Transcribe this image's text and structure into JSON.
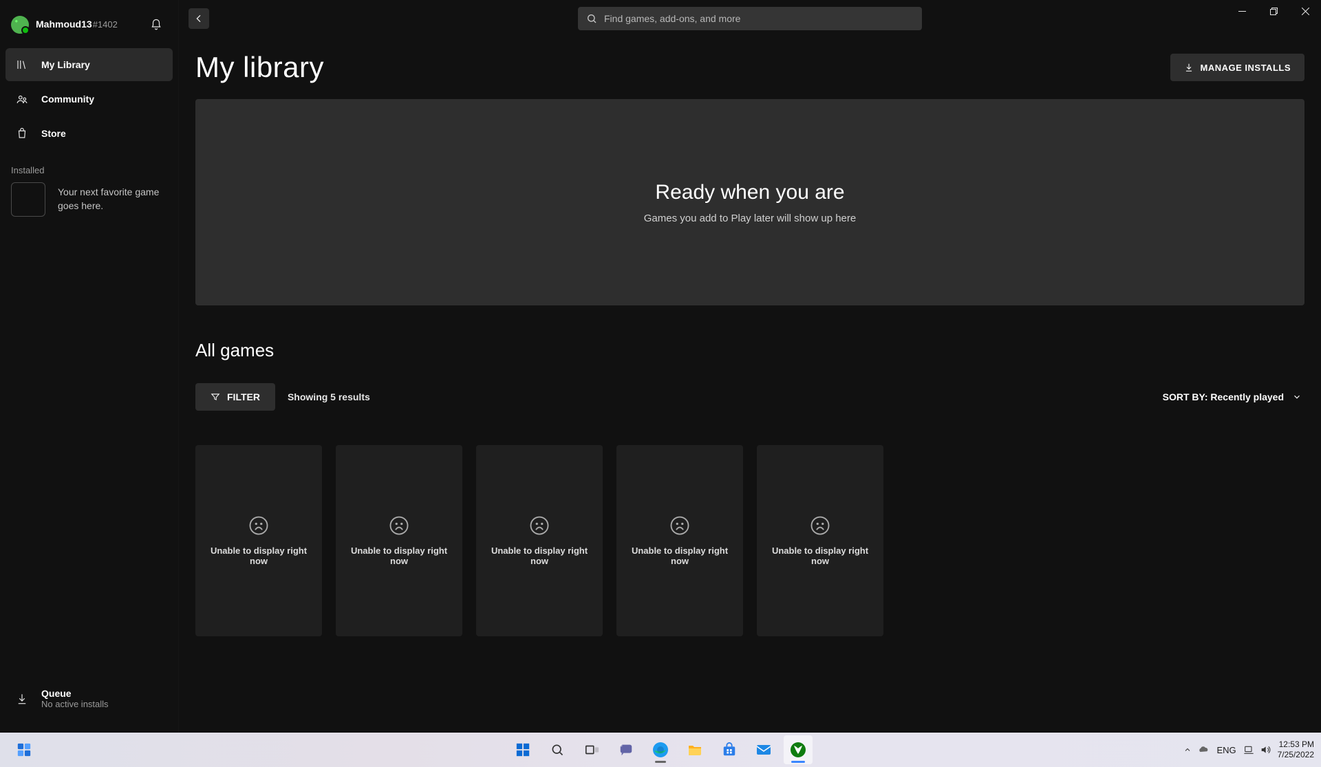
{
  "domain": "Computer-Use",
  "user": {
    "name": "Mahmoud13",
    "tag": "#1402"
  },
  "search": {
    "placeholder": "Find games, add-ons, and more"
  },
  "nav": {
    "library": "My Library",
    "community": "Community",
    "store": "Store"
  },
  "sidebar": {
    "installed_label": "Installed",
    "placeholder_text": "Your next favorite game goes here.",
    "queue_title": "Queue",
    "queue_sub": "No active installs"
  },
  "page": {
    "title": "My library",
    "manage_label": "MANAGE INSTALLS",
    "ready_title": "Ready when you are",
    "ready_sub": "Games you add to Play later will show up here",
    "all_games_label": "All games",
    "filter_label": "FILTER",
    "result_count": "Showing 5 results",
    "sort_prefix": "SORT BY:",
    "sort_value": "Recently played",
    "card_error": "Unable to display right now"
  },
  "taskbar": {
    "lang": "ENG",
    "time": "12:53 PM",
    "date": "7/25/2022"
  }
}
